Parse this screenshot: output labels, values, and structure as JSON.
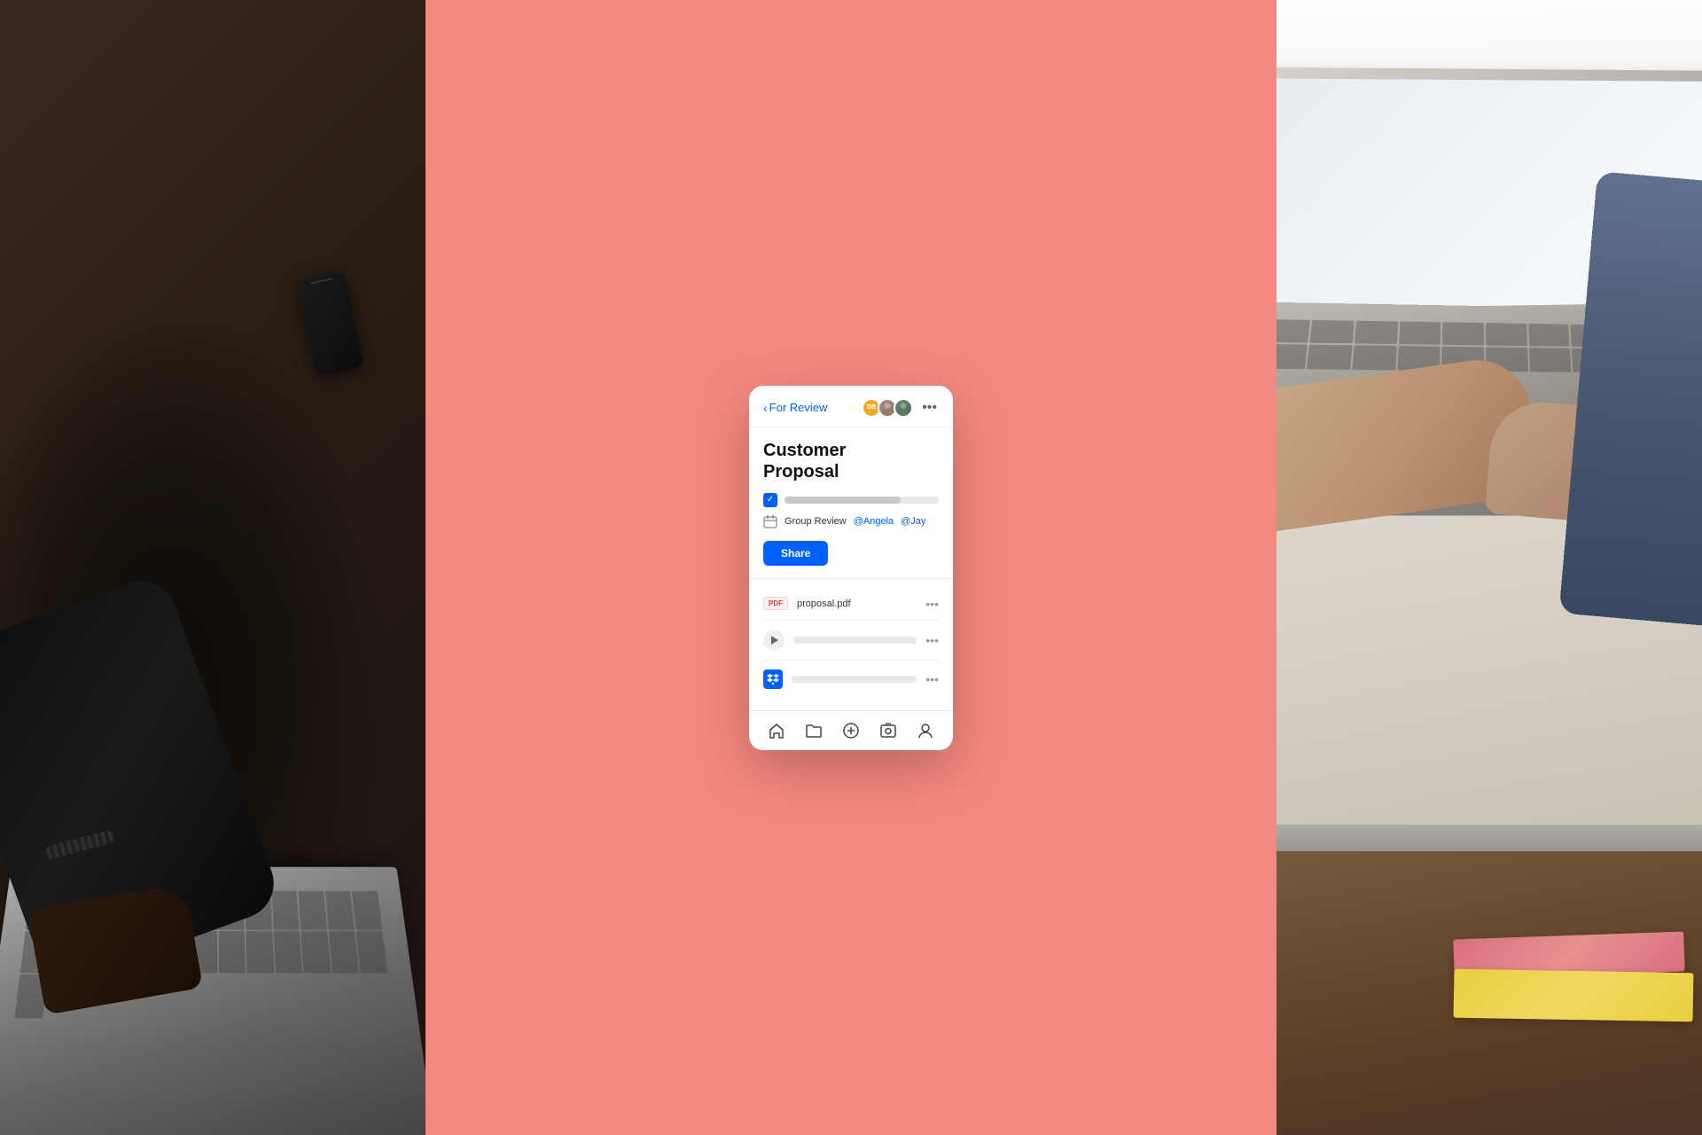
{
  "panels": {
    "left": {
      "alt": "Person with phone and laptop"
    },
    "center": {
      "bg_color": "#f5897f",
      "alt": "Dropbox mobile app screenshot"
    },
    "right": {
      "alt": "Person typing on laptop"
    }
  },
  "card": {
    "header": {
      "back_label": "For Review",
      "back_icon": "‹",
      "avatars": [
        {
          "initials": "DB",
          "type": "orange",
          "aria": "DB avatar"
        },
        {
          "type": "photo1",
          "aria": "User avatar 1"
        },
        {
          "type": "photo2",
          "aria": "User avatar 2"
        }
      ],
      "more_icon": "•••"
    },
    "title": "Customer\nProposal",
    "checkbox": {
      "checked": true
    },
    "group_review": {
      "label": "Group Review",
      "mention1": "@Angela",
      "mention2": "@Jay"
    },
    "share_button": "Share",
    "files": [
      {
        "type": "pdf",
        "icon_label": "PDF",
        "name": "proposal.pdf",
        "more": "•••"
      },
      {
        "type": "video",
        "more": "•••"
      },
      {
        "type": "dropbox",
        "more": "•••"
      }
    ],
    "nav": {
      "home_icon": "⌂",
      "folder_icon": "📁",
      "add_icon": "+",
      "photo_icon": "⊡",
      "user_icon": "👤"
    }
  }
}
